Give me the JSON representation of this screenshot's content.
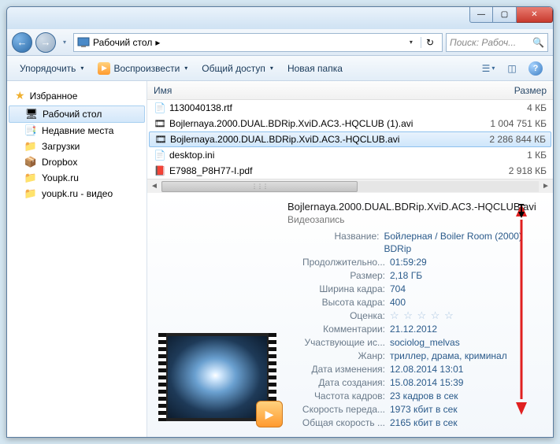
{
  "titlebar": {
    "min": "—",
    "max": "▢",
    "close": "✕"
  },
  "nav": {
    "back": "←",
    "forward": "→",
    "drop": "▾",
    "refresh": "↻"
  },
  "address": {
    "location": "Рабочий стол",
    "chevron": "▸"
  },
  "search": {
    "placeholder": "Поиск: Рабоч...",
    "icon": "🔍"
  },
  "toolbar": {
    "organize": "Упорядочить",
    "play": "Воспроизвести",
    "share": "Общий доступ",
    "newfolder": "Новая папка",
    "drop": "▾"
  },
  "sidebar": {
    "favorites": "Избранное",
    "items": [
      {
        "label": "Рабочий стол",
        "icon": "🖥"
      },
      {
        "label": "Недавние места",
        "icon": "📑"
      },
      {
        "label": "Загрузки",
        "icon": "📁"
      },
      {
        "label": "Dropbox",
        "icon": "📦"
      },
      {
        "label": "Youpk.ru",
        "icon": "📁"
      },
      {
        "label": "youpk.ru - видео",
        "icon": "📁"
      }
    ]
  },
  "columns": {
    "name": "Имя",
    "size": "Размер"
  },
  "files": [
    {
      "icon": "📄",
      "name": "1130040138.rtf",
      "size": "4 КБ",
      "sel": false
    },
    {
      "icon": "🎞",
      "name": "Bojlernaya.2000.DUAL.BDRip.XviD.AC3.-HQCLUB (1).avi",
      "size": "1 004 751 КБ",
      "sel": false
    },
    {
      "icon": "🎞",
      "name": "Bojlernaya.2000.DUAL.BDRip.XviD.AC3.-HQCLUB.avi",
      "size": "2 286 844 КБ",
      "sel": true
    },
    {
      "icon": "📄",
      "name": "desktop.ini",
      "size": "1 КБ",
      "sel": false
    },
    {
      "icon": "📕",
      "name": "E7988_P8H77-I.pdf",
      "size": "2 918 КБ",
      "sel": false
    }
  ],
  "details": {
    "title": "Bojlernaya.2000.DUAL.BDRip.XviD.AC3.-HQCLUB.avi",
    "type": "Видеозапись",
    "rows": [
      {
        "label": "Название:",
        "value": "Бойлерная / Boiler Room (2000) BDRip"
      },
      {
        "label": "Продолжительно...",
        "value": "01:59:29"
      },
      {
        "label": "Размер:",
        "value": "2,18 ГБ"
      },
      {
        "label": "Ширина кадра:",
        "value": "704"
      },
      {
        "label": "Высота кадра:",
        "value": "400"
      },
      {
        "label": "Оценка:",
        "value": "☆ ☆ ☆ ☆ ☆",
        "stars": true
      },
      {
        "label": "Комментарии:",
        "value": "21.12.2012"
      },
      {
        "label": "Участвующие ис...",
        "value": "sociolog_melvas"
      },
      {
        "label": "Жанр:",
        "value": "триллер, драма, криминал"
      },
      {
        "label": "Дата изменения:",
        "value": "12.08.2014 13:01"
      },
      {
        "label": "Дата создания:",
        "value": "15.08.2014 15:39"
      },
      {
        "label": "Частота кадров:",
        "value": "23 кадров в сек"
      },
      {
        "label": "Скорость переда...",
        "value": "1973 кбит в сек"
      },
      {
        "label": "Общая скорость ...",
        "value": "2165 кбит в сек"
      }
    ]
  }
}
